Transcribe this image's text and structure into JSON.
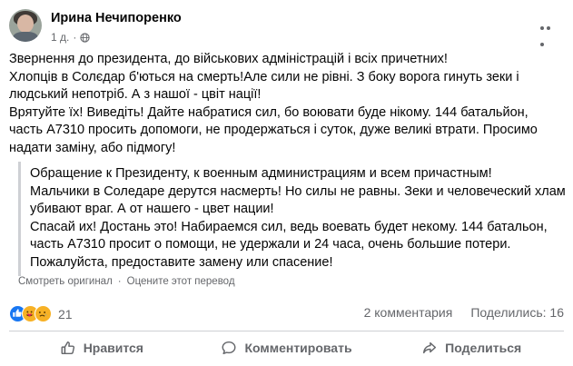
{
  "post": {
    "author": "Ирина Нечипоренко",
    "time": "1 д.",
    "body": [
      "Звернення до президента, до військових адміністрацій і всіх причетних!",
      "Хлопців в Солєдар  б'ються на смерть!Але сили не рівні. З боку ворога гинуть зеки і людський непотріб. А з нашої - цвіт нації!",
      "Врятуйте їх! Виведіть! Дайте набратися сил, бо воювати буде нікому. 144 батальйон, часть А7310 просить допомоги, не продержаться і суток, дуже великі втрати. Просимо надати заміну, або підмогу!"
    ],
    "translation": [
      "Обращение к Президенту, к военным администрациям и всем причастным!",
      "Мальчики в Соледаре дерутся насмерть! Но силы не равны. Зеки и человеческий хлам убивают враг. А от нашего - цвет нации!",
      "Спасай их! Достань это! Набираемся сил, ведь воевать будет некому. 144 батальон, часть А7310 просит о помощи, не удержали и 24 часа, очень большие потери. Пожалуйста, предоставите замену или спасение!"
    ],
    "see_original": "Смотреть оригинал",
    "rate_translation": "Оцените этот перевод",
    "separator": "·"
  },
  "stats": {
    "reaction_count": "21",
    "comments": "2 комментария",
    "shares": "Поделились: 16"
  },
  "actions": {
    "like": "Нравится",
    "comment": "Комментировать",
    "share": "Поделиться"
  },
  "colors": {
    "like_blue": "#1877f2",
    "secondary_text": "#65676b",
    "divider": "#ced0d4"
  }
}
